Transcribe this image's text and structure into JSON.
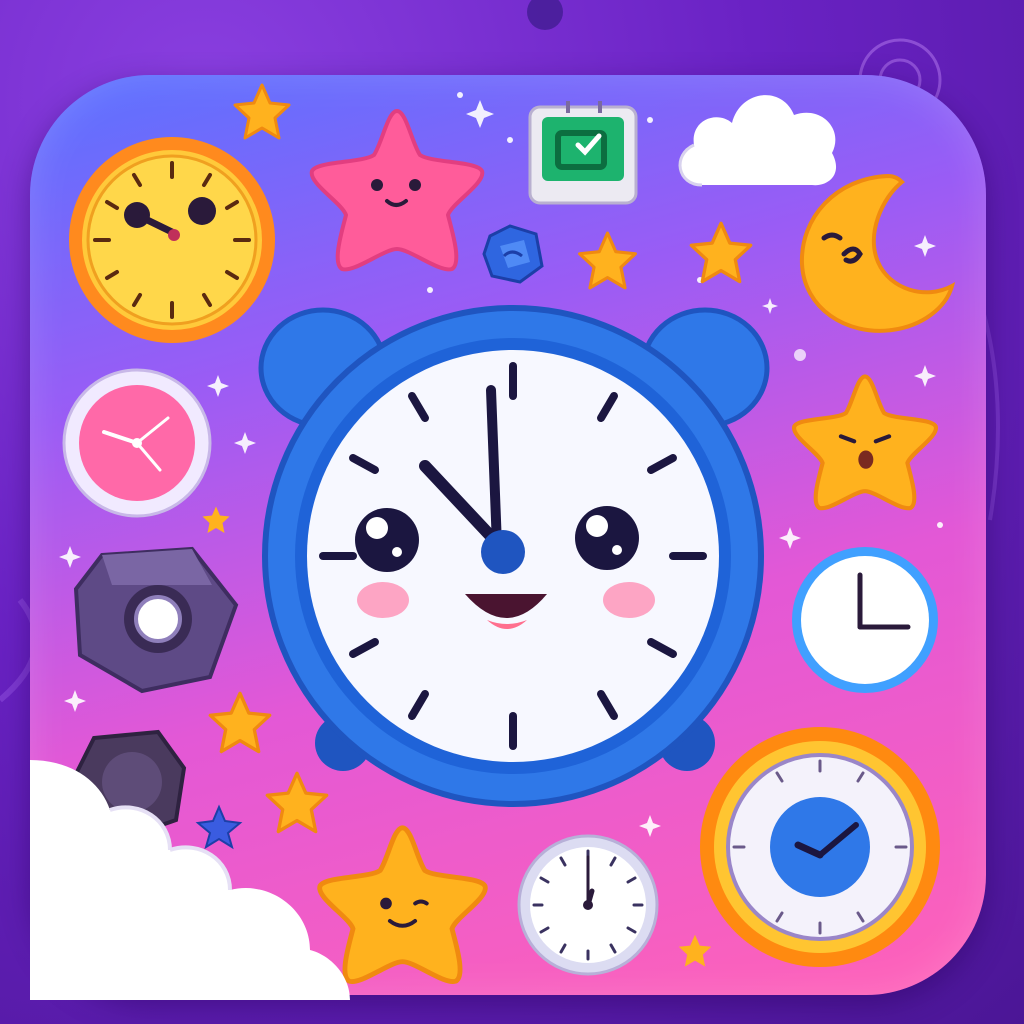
{
  "scene": {
    "main_alarm_clock": {
      "hour_hand_time": "11:00"
    },
    "icons": [
      "sun-clock-icon",
      "pink-star-face-icon",
      "green-calendar-icon",
      "cloud-icon",
      "moon-face-icon",
      "pink-clock-icon",
      "gray-gem-button-icon",
      "orange-star-face-icon",
      "white-clock-icon",
      "yellow-star-icon",
      "dial-clock-icon",
      "orange-clock-icon",
      "smiling-star-icon",
      "blue-gem-icon",
      "dark-knob-icon",
      "cloud-corner-icon"
    ]
  },
  "colors": {
    "background": "#6a22c4",
    "tile_top": "#5a72ff",
    "tile_bottom": "#ff62b8",
    "alarm_body": "#2f78e8",
    "star_yellow": "#ffb21e",
    "star_pink": "#ff5c9a",
    "face_dark": "#2a1a3a"
  }
}
